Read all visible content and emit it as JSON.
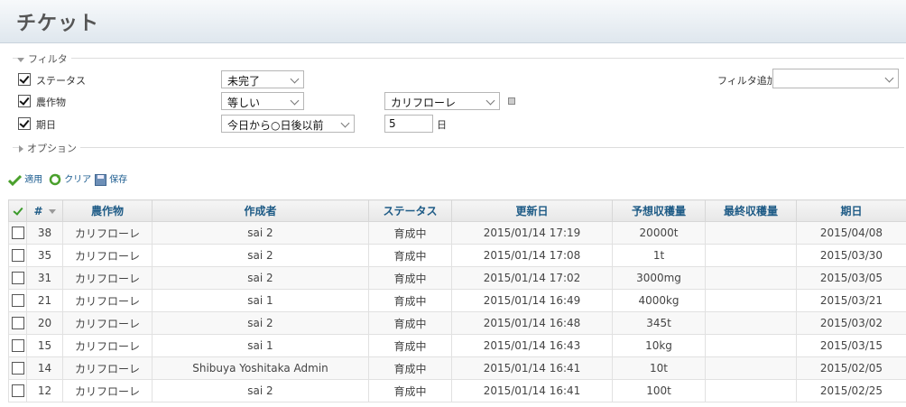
{
  "page": {
    "title": "チケット"
  },
  "filters": {
    "legend": "フィルタ",
    "rows": [
      {
        "label": "ステータス",
        "operator": "未完了",
        "checked": true
      },
      {
        "label": "農作物",
        "operator": "等しい",
        "value": "カリフローレ",
        "checked": true
      },
      {
        "label": "期日",
        "operator": "今日から○日後以前",
        "value": "5",
        "unit": "日",
        "checked": true
      }
    ],
    "add_filter_label": "フィルタ追加",
    "add_filter_value": ""
  },
  "options": {
    "legend": "オプション"
  },
  "actions": {
    "apply": "適用",
    "clear": "クリア",
    "save": "保存"
  },
  "table": {
    "columns": [
      "#",
      "農作物",
      "作成者",
      "ステータス",
      "更新日",
      "予想収穫量",
      "最終収穫量",
      "期日"
    ],
    "rows": [
      {
        "id": "38",
        "crop": "カリフローレ",
        "author": "sai 2",
        "status": "育成中",
        "updated": "2015/01/14 17:19",
        "expected": "20000t",
        "final": "",
        "due": "2015/04/08"
      },
      {
        "id": "35",
        "crop": "カリフローレ",
        "author": "sai 2",
        "status": "育成中",
        "updated": "2015/01/14 17:08",
        "expected": "1t",
        "final": "",
        "due": "2015/03/30"
      },
      {
        "id": "31",
        "crop": "カリフローレ",
        "author": "sai 2",
        "status": "育成中",
        "updated": "2015/01/14 17:02",
        "expected": "3000mg",
        "final": "",
        "due": "2015/03/05"
      },
      {
        "id": "21",
        "crop": "カリフローレ",
        "author": "sai 1",
        "status": "育成中",
        "updated": "2015/01/14 16:49",
        "expected": "4000kg",
        "final": "",
        "due": "2015/03/21"
      },
      {
        "id": "20",
        "crop": "カリフローレ",
        "author": "sai 2",
        "status": "育成中",
        "updated": "2015/01/14 16:48",
        "expected": "345t",
        "final": "",
        "due": "2015/03/02"
      },
      {
        "id": "15",
        "crop": "カリフローレ",
        "author": "sai 1",
        "status": "育成中",
        "updated": "2015/01/14 16:43",
        "expected": "10kg",
        "final": "",
        "due": "2015/03/15"
      },
      {
        "id": "14",
        "crop": "カリフローレ",
        "author": "Shibuya Yoshitaka Admin",
        "status": "育成中",
        "updated": "2015/01/14 16:41",
        "expected": "10t",
        "final": "",
        "due": "2015/02/05"
      },
      {
        "id": "12",
        "crop": "カリフローレ",
        "author": "sai 2",
        "status": "育成中",
        "updated": "2015/01/14 16:41",
        "expected": "100t",
        "final": "",
        "due": "2015/02/25"
      }
    ]
  }
}
